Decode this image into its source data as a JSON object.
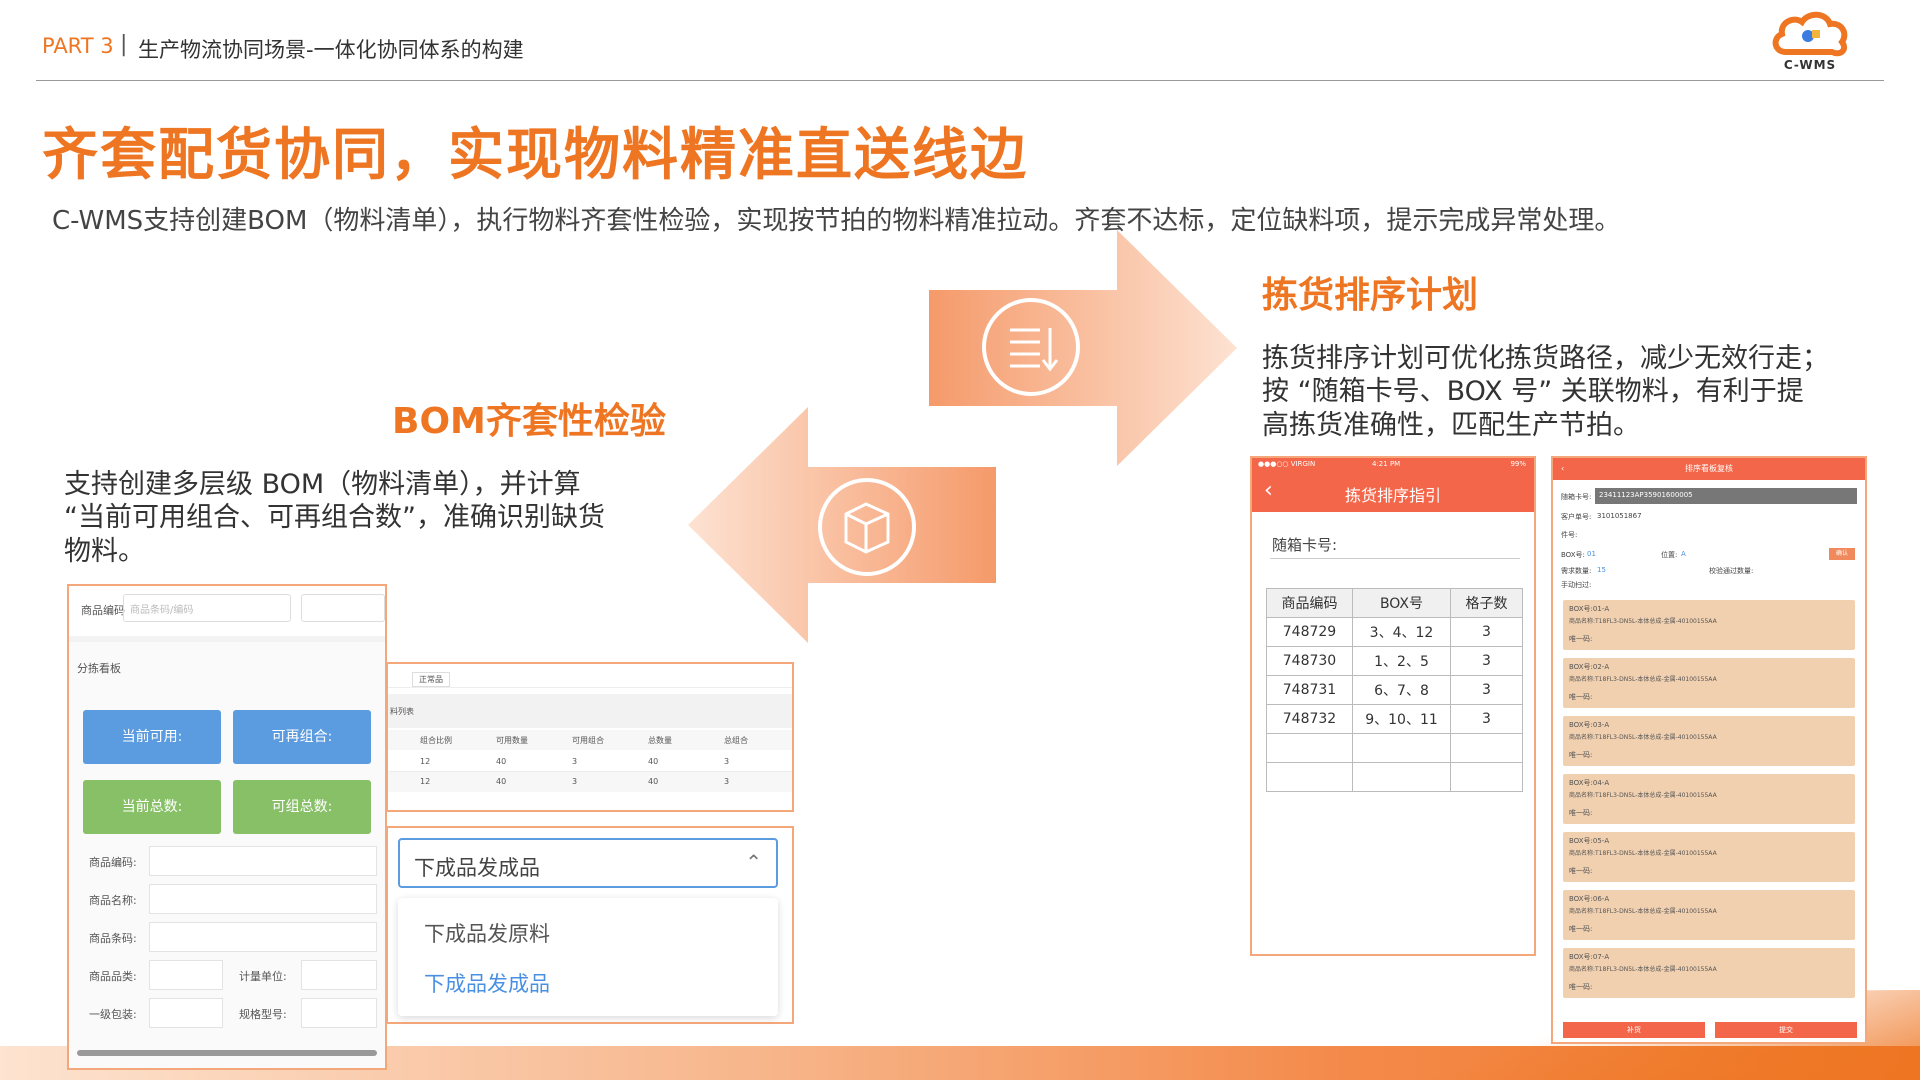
{
  "header": {
    "part": "PART 3",
    "separator": "|",
    "title": "生产物流协同场景-一体化协同体系的构建",
    "logo_text": "C-WMS"
  },
  "main": {
    "title": "齐套配货协同，实现物料精准直送线边",
    "subtitle": "C-WMS支持创建BOM（物料清单），执行物料齐套性检验，实现按节拍的物料精准拉动。齐套不达标，定位缺料项，提示完成异常处理。"
  },
  "section_pick": {
    "title": "拣货排序计划",
    "lines": [
      "拣货排序计划可优化拣货路径，减少无效行走；",
      "按 “随箱卡号、BOX 号” 关联物料，有利于提",
      "高拣货准确性，匹配生产节拍。"
    ]
  },
  "section_bom": {
    "title": "BOM齐套性检验",
    "lines": [
      "支持创建多层级 BOM（物料清单），并计算",
      "“当前可用组合、可再组合数”，准确识别缺货",
      "物料。"
    ]
  },
  "shot_kanban": {
    "code_label": "商品编码",
    "code_placeholder": "商品条码/编码",
    "board_label": "分拣看板",
    "btn_available": "当前可用:",
    "btn_recombine": "可再组合:",
    "btn_total": "当前总数:",
    "btn_group_total": "可组总数:",
    "fields": [
      "商品编码:",
      "商品名称:",
      "商品条码:"
    ],
    "field_category": "商品品类:",
    "field_unit": "计量单位:",
    "field_pack": "一级包装:",
    "field_spec": "规格型号:"
  },
  "shot_table": {
    "filter": "正常品",
    "list_label": "料列表",
    "headers": [
      "组合比例",
      "可用数量",
      "可用组合",
      "总数量",
      "总组合"
    ],
    "rows": [
      [
        "12",
        "40",
        "3",
        "40",
        "3"
      ],
      [
        "12",
        "40",
        "3",
        "40",
        "3"
      ]
    ]
  },
  "shot_dropdown": {
    "selected": "下成品发成品",
    "options": [
      "下成品发原料",
      "下成品发成品"
    ],
    "active_color": "#4a90e2"
  },
  "shot_phone": {
    "status_carrier": "●●●○○ VIRGIN",
    "status_time": "4:21 PM",
    "status_battery": "99%",
    "title": "拣货排序指引",
    "card_label": "随箱卡号:",
    "headers": [
      "商品编码",
      "BOX号",
      "格子数"
    ],
    "rows": [
      [
        "748729",
        "3、4、12",
        "3"
      ],
      [
        "748730",
        "1、2、5",
        "3"
      ],
      [
        "748731",
        "6、7、8",
        "3"
      ],
      [
        "748732",
        "9、10、11",
        "3"
      ],
      [
        "",
        "",
        ""
      ],
      [
        "",
        "",
        ""
      ]
    ]
  },
  "shot_boxes": {
    "title": "排序看板复核",
    "card_no_label": "随箱卡号:",
    "card_no_value": "23411123AP35901600005",
    "customer_label": "客户单号:",
    "customer_value": "3101051867",
    "part_label": "件号:",
    "box_label": "BOX号:",
    "box_value": "01",
    "position_label": "位置:",
    "position_value": "A",
    "confirm": "确认",
    "required_label": "需求数量:",
    "required_value": "15",
    "passed_label": "校验通过数量:",
    "manual_label": "手动扫过:",
    "boxes": [
      {
        "id": "BOX号:01-A",
        "name": "商品名称:T18FL3-DN5L-本体总成-金属-40100155AA",
        "unique": "唯一码:"
      },
      {
        "id": "BOX号:02-A",
        "name": "商品名称:T18FL3-DN5L-本体总成-金属-40100155AA",
        "unique": "唯一码:"
      },
      {
        "id": "BOX号:03-A",
        "name": "商品名称:T18FL3-DN5L-本体总成-金属-40100155AA",
        "unique": "唯一码:"
      },
      {
        "id": "BOX号:04-A",
        "name": "商品名称:T18FL3-DN5L-本体总成-金属-40100155AA",
        "unique": "唯一码:"
      },
      {
        "id": "BOX号:05-A",
        "name": "商品名称:T18FL3-DN5L-本体总成-金属-40100155AA",
        "unique": "唯一码:"
      },
      {
        "id": "BOX号:06-A",
        "name": "商品名称:T18FL3-DN5L-本体总成-金属-40100155AA",
        "unique": "唯一码:"
      },
      {
        "id": "BOX号:07-A",
        "name": "商品名称:T18FL3-DN5L-本体总成-金属-40100155AA",
        "unique": "唯一码:"
      }
    ],
    "btn_left": "补货",
    "btn_right": "提交"
  },
  "icons": {
    "sort": "sort-list-icon",
    "box": "package-box-icon",
    "logo": "cloud-logo-icon"
  },
  "colors": {
    "accent": "#ee7623",
    "phone_header": "#f4664a",
    "blue_button": "#5b9be0",
    "green_button": "#88c068"
  }
}
